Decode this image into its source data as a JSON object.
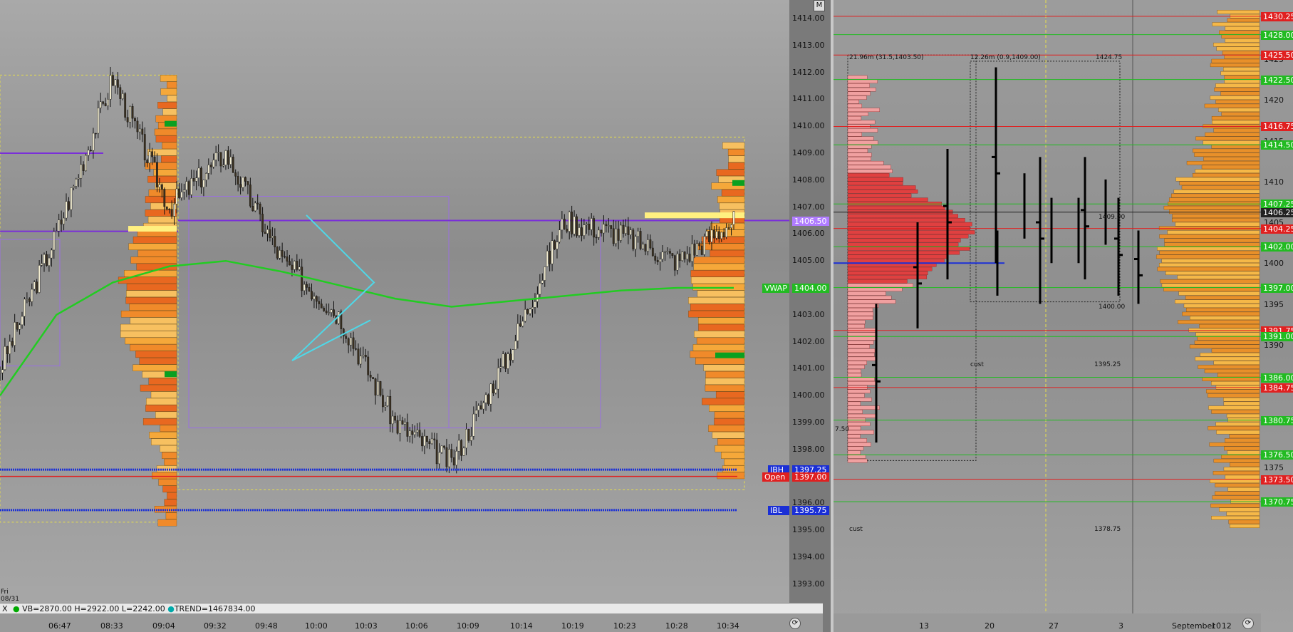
{
  "left_chart": {
    "day_label": "Fri",
    "date_label": "08/31",
    "status": {
      "vb": "VB=2870.00",
      "h": "H=2922.00",
      "l": "L=2242.00",
      "trend": "TREND=1467834.00"
    },
    "close_x_label": "X",
    "corner_label": "M",
    "price_ticks": [
      "1414.00",
      "1413.00",
      "1412.00",
      "1411.00",
      "1410.00",
      "1409.00",
      "1408.00",
      "1407.00",
      "1406.00",
      "1405.00",
      "1404.00",
      "1403.00",
      "1402.00",
      "1401.00",
      "1400.00",
      "1399.00",
      "1398.00",
      "1397.00",
      "1396.00",
      "1395.00",
      "1394.00",
      "1393.00"
    ],
    "time_ticks": [
      "06:47",
      "08:33",
      "09:04",
      "09:32",
      "09:48",
      "10:00",
      "10:03",
      "10:06",
      "10:09",
      "10:14",
      "10:19",
      "10:23",
      "10:28",
      "10:34"
    ],
    "levels": [
      {
        "name": "",
        "value": "1406.50",
        "tag": "",
        "color": "#b07cff"
      },
      {
        "name": "VWAP",
        "value": "1404.00",
        "tag": "VWAP",
        "color": "#22bb22"
      },
      {
        "name": "IBH",
        "value": "1397.25",
        "tag": "IBH",
        "color": "#1a2fd6"
      },
      {
        "name": "Open",
        "value": "1397.00",
        "tag": "Open",
        "color": "#e02020"
      },
      {
        "name": "IBL",
        "value": "1395.75",
        "tag": "IBL",
        "color": "#1a2fd6"
      }
    ]
  },
  "right_chart": {
    "annotations": {
      "a1": "21.96m (31.5,1403.50)",
      "a2": "12.26m (0.9,1409.00)",
      "a3": "1424.75",
      "a4": "1409.00",
      "a5": "1400.00",
      "a6": "1395.25",
      "a7": "cust",
      "a8": "cust",
      "a9": "1378.75",
      "a10": "7.50"
    },
    "price_ticks": [
      "1425",
      "1420",
      "1415",
      "1410",
      "1405",
      "1400",
      "1395",
      "1390",
      "1375"
    ],
    "levels": [
      {
        "value": "1430.25",
        "color": "#e02020"
      },
      {
        "value": "1428.00",
        "color": "#22bb22"
      },
      {
        "value": "1425.50",
        "color": "#e02020"
      },
      {
        "value": "1422.50",
        "color": "#22bb22"
      },
      {
        "value": "1416.75",
        "color": "#e02020"
      },
      {
        "value": "1414.50",
        "color": "#22bb22"
      },
      {
        "value": "1407.25",
        "color": "#22bb22"
      },
      {
        "value": "1406.25",
        "color": "#222222"
      },
      {
        "value": "1404.25",
        "color": "#e02020"
      },
      {
        "value": "1402.00",
        "color": "#22bb22"
      },
      {
        "value": "1397.00",
        "color": "#22bb22"
      },
      {
        "value": "1391.75",
        "color": "#e02020"
      },
      {
        "value": "1391.00",
        "color": "#22bb22"
      },
      {
        "value": "1386.00",
        "color": "#22bb22"
      },
      {
        "value": "1384.75",
        "color": "#e02020"
      },
      {
        "value": "1380.75",
        "color": "#22bb22"
      },
      {
        "value": "1376.50",
        "color": "#22bb22"
      },
      {
        "value": "1373.50",
        "color": "#e02020"
      },
      {
        "value": "1370.75",
        "color": "#22bb22"
      }
    ],
    "date_ticks": [
      "13",
      "20",
      "27",
      "3",
      "September `12",
      "10"
    ]
  },
  "chart_data": [
    {
      "type": "candlestick",
      "title": "",
      "xlabel": "",
      "ylabel": "",
      "ylim": [
        1392.5,
        1414.5
      ],
      "x": [
        "06:47",
        "08:33",
        "09:04",
        "09:32",
        "09:48",
        "10:00",
        "10:03",
        "10:06",
        "10:09",
        "10:14",
        "10:19",
        "10:23",
        "10:28",
        "10:34"
      ],
      "series": [
        {
          "values": [
            1401.0,
            1406.0,
            1411.8,
            1407.0,
            1409.0,
            1405.0,
            1403.0,
            1399.0,
            1397.5,
            1401.5,
            1406.5,
            1406.0,
            1405.0,
            1406.5
          ]
        },
        {
          "name": "VWAP",
          "values": [
            1400.0,
            1403.0,
            1404.2,
            1404.8,
            1405.0,
            1404.6,
            1404.1,
            1403.6,
            1403.3,
            1403.5,
            1403.7,
            1403.9,
            1404.0,
            1404.0
          ]
        }
      ],
      "grid": false
    },
    {
      "type": "bar",
      "title": "",
      "ylim": [
        1368.0,
        1432.0
      ],
      "x": [
        "13",
        "20",
        "27",
        "3",
        "10"
      ],
      "series": [
        {
          "values": [
            1400.0,
            1407.0,
            1404.0,
            1404.0,
            1406.25
          ]
        }
      ],
      "grid": false
    }
  ]
}
